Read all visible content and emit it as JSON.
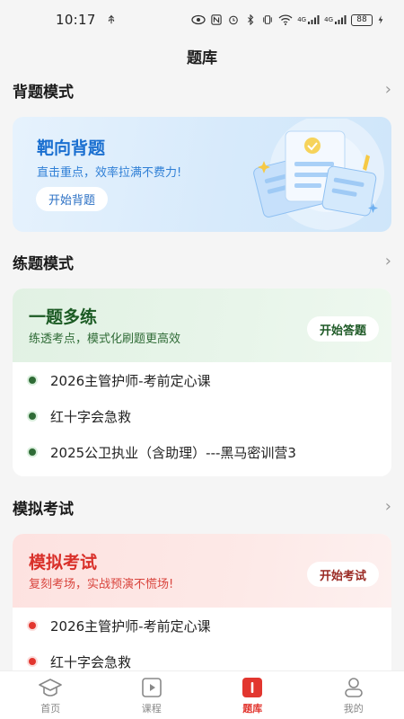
{
  "status_bar": {
    "time": "10:17",
    "battery": "88",
    "net_a": "4G",
    "net_b": "4G"
  },
  "page": {
    "title": "题库"
  },
  "recite_section": {
    "title": "背题模式",
    "card": {
      "title": "靶向背题",
      "subtitle": "直击重点，效率拉满不费力!",
      "button": "开始背题"
    }
  },
  "practice_section": {
    "title": "练题模式",
    "card": {
      "title": "一题多练",
      "subtitle": "练透考点，模式化刷题更高效",
      "button": "开始答题"
    },
    "items": [
      "2026主管护师-考前定心课",
      "红十字会急救",
      "2025公卫执业（含助理）---黑马密训营3"
    ]
  },
  "exam_section": {
    "title": "模拟考试",
    "card": {
      "title": "模拟考试",
      "subtitle": "复刻考场，实战预演不慌场!",
      "button": "开始考试"
    },
    "items": [
      "2026主管护师-考前定心课",
      "红十字会急救"
    ]
  },
  "tabbar": {
    "tabs": [
      {
        "label": "首页",
        "icon": "graduation-cap-icon"
      },
      {
        "label": "课程",
        "icon": "video-play-icon"
      },
      {
        "label": "题库",
        "icon": "question-bank-icon"
      },
      {
        "label": "我的",
        "icon": "user-icon"
      }
    ],
    "active_index": 2
  },
  "colors": {
    "accent": "#e2362f",
    "blue": "#1a6fd0",
    "green": "#1b5a23",
    "red": "#d9302a"
  }
}
